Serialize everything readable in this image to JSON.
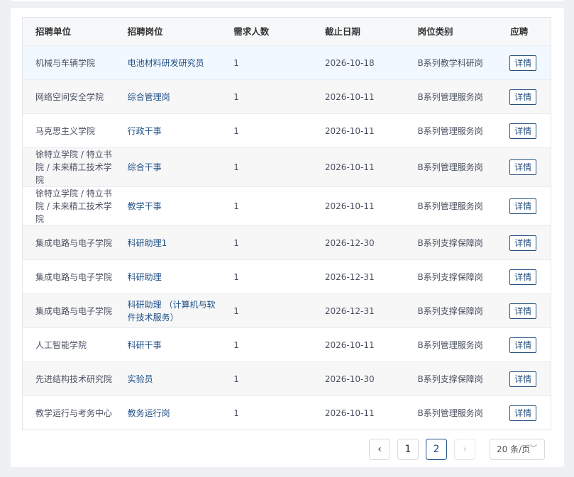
{
  "table": {
    "headers": [
      "招聘单位",
      "招聘岗位",
      "需求人数",
      "截止日期",
      "岗位类别",
      "应聘"
    ],
    "detail_label": "详情",
    "rows": [
      {
        "unit": "机械与车辆学院",
        "post": "电池材料研发研究员",
        "count": "1",
        "deadline": "2026-10-18",
        "category": "B系列教学科研岗"
      },
      {
        "unit": "网络空间安全学院",
        "post": "综合管理岗",
        "count": "1",
        "deadline": "2026-10-11",
        "category": "B系列管理服务岗"
      },
      {
        "unit": "马克思主义学院",
        "post": "行政干事",
        "count": "1",
        "deadline": "2026-10-11",
        "category": "B系列管理服务岗"
      },
      {
        "unit": "徐特立学院 / 特立书院 / 未来精工技术学院",
        "post": "综合干事",
        "count": "1",
        "deadline": "2026-10-11",
        "category": "B系列管理服务岗"
      },
      {
        "unit": "徐特立学院 / 特立书院 / 未来精工技术学院",
        "post": "教学干事",
        "count": "1",
        "deadline": "2026-10-11",
        "category": "B系列管理服务岗"
      },
      {
        "unit": "集成电路与电子学院",
        "post": "科研助理1",
        "count": "1",
        "deadline": "2026-12-30",
        "category": "B系列支撑保障岗"
      },
      {
        "unit": "集成电路与电子学院",
        "post": "科研助理",
        "count": "1",
        "deadline": "2026-12-31",
        "category": "B系列支撑保障岗"
      },
      {
        "unit": "集成电路与电子学院",
        "post": "科研助理 （计算机与软件技术服务）",
        "count": "1",
        "deadline": "2026-12-31",
        "category": "B系列支撑保障岗"
      },
      {
        "unit": "人工智能学院",
        "post": "科研干事",
        "count": "1",
        "deadline": "2026-10-11",
        "category": "B系列管理服务岗"
      },
      {
        "unit": "先进结构技术研究院",
        "post": "实验员",
        "count": "1",
        "deadline": "2026-10-30",
        "category": "B系列支撑保障岗"
      },
      {
        "unit": "教学运行与考务中心",
        "post": "教务运行岗",
        "count": "1",
        "deadline": "2026-10-11",
        "category": "B系列管理服务岗"
      }
    ]
  },
  "pagination": {
    "prev_icon": "‹",
    "next_icon": "›",
    "pages": [
      "1",
      "2"
    ],
    "current_page": "2",
    "page_size": "20 条/页",
    "page_size_icon": "﹀"
  },
  "colors": {
    "accent": "#1e4f86",
    "highlight_row": "#f2f8ff"
  }
}
